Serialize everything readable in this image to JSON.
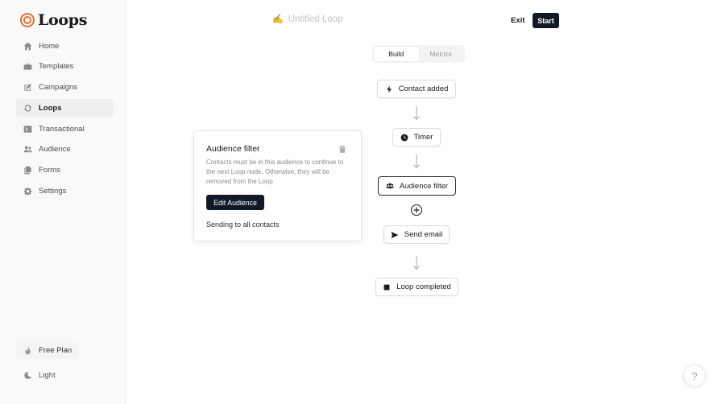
{
  "app": {
    "name": "Loops",
    "brand_color": "#e8702a"
  },
  "sidebar": {
    "items": [
      {
        "label": "Home",
        "icon": "home-icon",
        "active": false
      },
      {
        "label": "Templates",
        "icon": "briefcase-icon",
        "active": false
      },
      {
        "label": "Campaigns",
        "icon": "edit-icon",
        "active": false
      },
      {
        "label": "Loops",
        "icon": "refresh-icon",
        "active": true
      },
      {
        "label": "Transactional",
        "icon": "terminal-icon",
        "active": false
      },
      {
        "label": "Audience",
        "icon": "users-icon",
        "active": false
      },
      {
        "label": "Forms",
        "icon": "copy-icon",
        "active": false
      },
      {
        "label": "Settings",
        "icon": "gear-icon",
        "active": false
      }
    ],
    "plan_label": "Free Plan",
    "theme_label": "Light"
  },
  "header": {
    "title": "Untitled Loop",
    "exit_label": "Exit",
    "start_label": "Start"
  },
  "tabs": [
    {
      "label": "Build",
      "active": true
    },
    {
      "label": "Metrics",
      "active": false
    }
  ],
  "flow": {
    "nodes": [
      {
        "label": "Contact added",
        "icon": "lightning-icon"
      },
      {
        "label": "Timer",
        "icon": "clock-icon"
      },
      {
        "label": "Audience filter",
        "icon": "users-icon",
        "selected": true
      },
      {
        "label": "Send email",
        "icon": "send-icon"
      },
      {
        "label": "Loop completed",
        "icon": "stop-icon"
      }
    ]
  },
  "panel": {
    "title": "Audience filter",
    "description": "Contacts must be in this audience to continue to the next Loop node. Otherwise, they will be removed from the Loop",
    "button_label": "Edit Audience",
    "status": "Sending to all contacts"
  },
  "help_label": "?"
}
